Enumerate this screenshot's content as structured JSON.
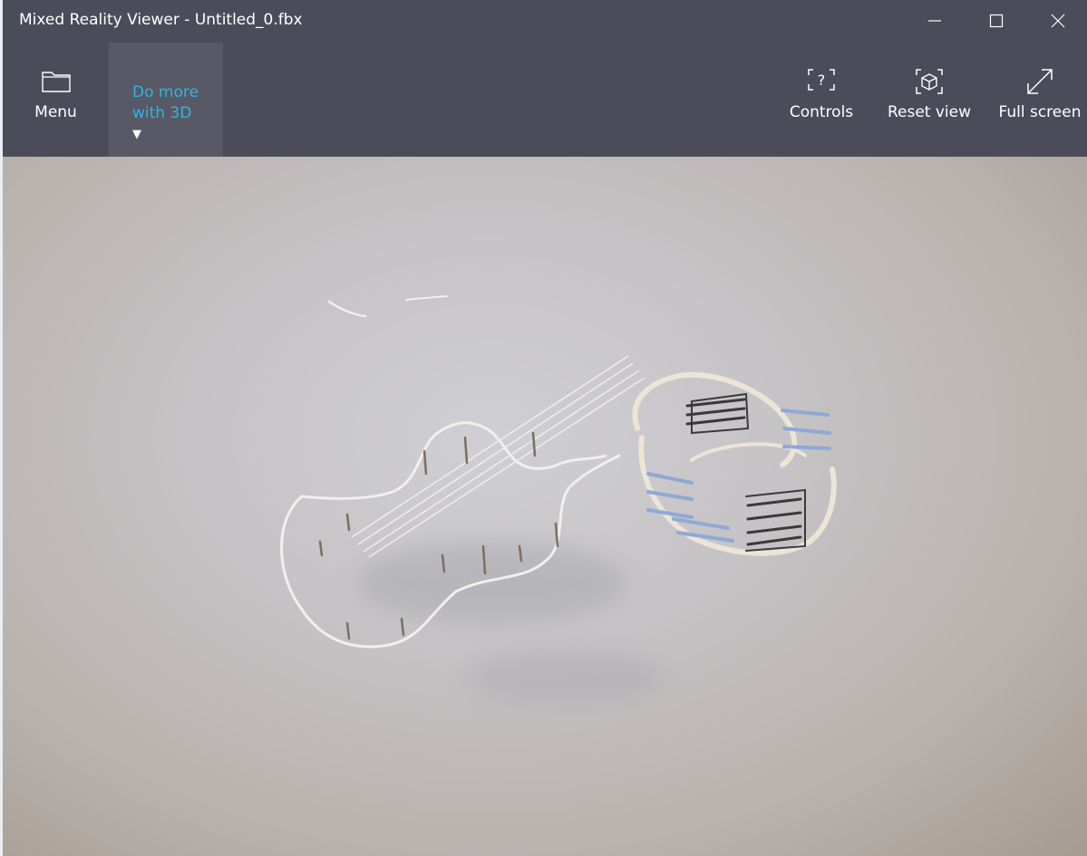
{
  "window": {
    "title": "Mixed Reality Viewer - Untitled_0.fbx",
    "controls": {
      "minimize_icon": "minimize-icon",
      "maximize_icon": "maximize-icon",
      "close_icon": "close-icon"
    }
  },
  "toolbar": {
    "menu_label": "Menu",
    "menu_icon": "folder-icon",
    "do_more_label": "Do more with 3D",
    "do_more_caret": "▼",
    "controls_label": "Controls",
    "controls_icon": "help-bracket-icon",
    "reset_view_label": "Reset view",
    "reset_view_icon": "cube-reset-icon",
    "full_screen_label": "Full screen",
    "full_screen_icon": "expand-diagonal-icon"
  },
  "colors": {
    "header_bg": "#4a4c59",
    "accent": "#2fb4e0",
    "viewport_bg": "#c6c3c6"
  },
  "viewport": {
    "content": "3D model scene"
  }
}
